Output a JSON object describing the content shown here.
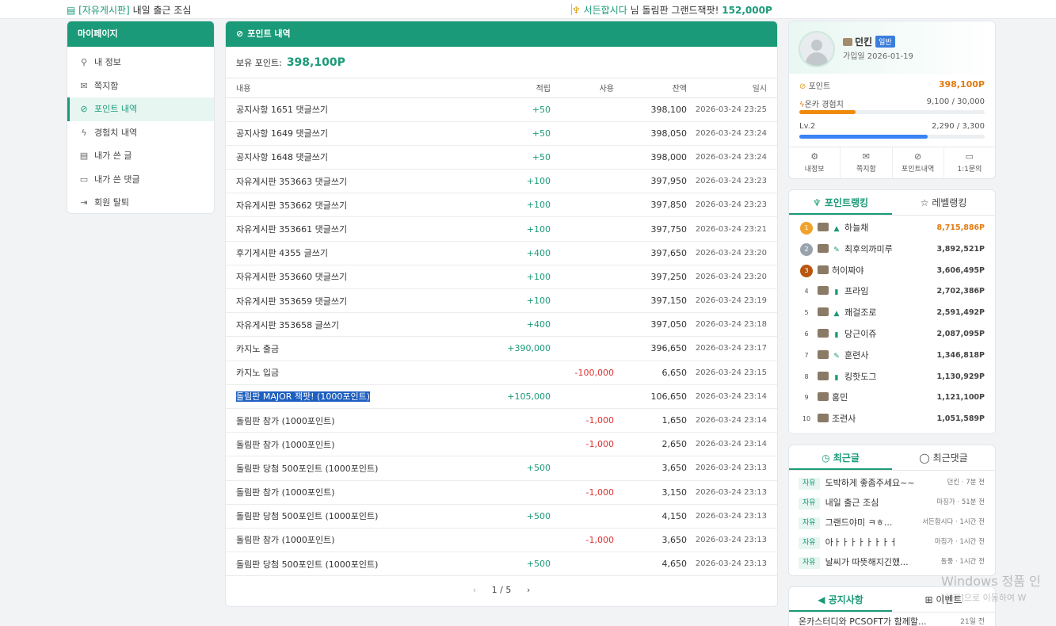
{
  "ticker": {
    "left_category": "[자유게시판]",
    "left_title": "내일 출근 조심",
    "right_nick": "서든합시다",
    "right_suffix": "님",
    "right_text": "돌림판 그랜드잭팟!",
    "right_amount": "152,000P"
  },
  "mypage": {
    "title": "마이페이지",
    "items": [
      {
        "label": "내 정보",
        "icon": "user-icon"
      },
      {
        "label": "쪽지함",
        "icon": "mail-icon"
      },
      {
        "label": "포인트 내역",
        "icon": "link-icon"
      },
      {
        "label": "경험치 내역",
        "icon": "bolt-icon"
      },
      {
        "label": "내가 쓴 글",
        "icon": "document-icon"
      },
      {
        "label": "내가 쓴 댓글",
        "icon": "comment-icon"
      },
      {
        "label": "회원 탈퇴",
        "icon": "logout-icon"
      }
    ]
  },
  "points": {
    "title": "포인트 내역",
    "balance_label": "보유 포인트:",
    "balance_value": "398,100P",
    "columns": [
      "내용",
      "적립",
      "사용",
      "잔액",
      "일시"
    ],
    "rows": [
      {
        "desc": "공지사항 1651 댓글쓰기",
        "earn": "+50",
        "use": "",
        "bal": "398,100",
        "date": "2026-03-24 23:25"
      },
      {
        "desc": "공지사항 1649 댓글쓰기",
        "earn": "+50",
        "use": "",
        "bal": "398,050",
        "date": "2026-03-24 23:24"
      },
      {
        "desc": "공지사항 1648 댓글쓰기",
        "earn": "+50",
        "use": "",
        "bal": "398,000",
        "date": "2026-03-24 23:24"
      },
      {
        "desc": "자유게시판 353663 댓글쓰기",
        "earn": "+100",
        "use": "",
        "bal": "397,950",
        "date": "2026-03-24 23:23"
      },
      {
        "desc": "자유게시판 353662 댓글쓰기",
        "earn": "+100",
        "use": "",
        "bal": "397,850",
        "date": "2026-03-24 23:23"
      },
      {
        "desc": "자유게시판 353661 댓글쓰기",
        "earn": "+100",
        "use": "",
        "bal": "397,750",
        "date": "2026-03-24 23:21"
      },
      {
        "desc": "후기게시판 4355 글쓰기",
        "earn": "+400",
        "use": "",
        "bal": "397,650",
        "date": "2026-03-24 23:20"
      },
      {
        "desc": "자유게시판 353660 댓글쓰기",
        "earn": "+100",
        "use": "",
        "bal": "397,250",
        "date": "2026-03-24 23:20"
      },
      {
        "desc": "자유게시판 353659 댓글쓰기",
        "earn": "+100",
        "use": "",
        "bal": "397,150",
        "date": "2026-03-24 23:19"
      },
      {
        "desc": "자유게시판 353658 글쓰기",
        "earn": "+400",
        "use": "",
        "bal": "397,050",
        "date": "2026-03-24 23:18"
      },
      {
        "desc": "카지노 출금",
        "earn": "+390,000",
        "use": "",
        "bal": "396,650",
        "date": "2026-03-24 23:17"
      },
      {
        "desc": "카지노 입금",
        "earn": "",
        "use": "-100,000",
        "bal": "6,650",
        "date": "2026-03-24 23:15"
      },
      {
        "desc": "돌림판 MAJOR 잭팟! (1000포인트)",
        "earn": "+105,000",
        "use": "",
        "bal": "106,650",
        "date": "2026-03-24 23:14",
        "selected": true
      },
      {
        "desc": "돌림판 참가 (1000포인트)",
        "earn": "",
        "use": "-1,000",
        "bal": "1,650",
        "date": "2026-03-24 23:14"
      },
      {
        "desc": "돌림판 참가 (1000포인트)",
        "earn": "",
        "use": "-1,000",
        "bal": "2,650",
        "date": "2026-03-24 23:14"
      },
      {
        "desc": "돌림판 당첨 500포인트 (1000포인트)",
        "earn": "+500",
        "use": "",
        "bal": "3,650",
        "date": "2026-03-24 23:13"
      },
      {
        "desc": "돌림판 참가 (1000포인트)",
        "earn": "",
        "use": "-1,000",
        "bal": "3,150",
        "date": "2026-03-24 23:13"
      },
      {
        "desc": "돌림판 당첨 500포인트 (1000포인트)",
        "earn": "+500",
        "use": "",
        "bal": "4,150",
        "date": "2026-03-24 23:13"
      },
      {
        "desc": "돌림판 참가 (1000포인트)",
        "earn": "",
        "use": "-1,000",
        "bal": "3,650",
        "date": "2026-03-24 23:13"
      },
      {
        "desc": "돌림판 당첨 500포인트 (1000포인트)",
        "earn": "+500",
        "use": "",
        "bal": "4,650",
        "date": "2026-03-24 23:13"
      }
    ],
    "pager": {
      "prev": "‹",
      "current": "1 / 5",
      "next": "›"
    }
  },
  "profile": {
    "name": "던킨",
    "badge": "일반",
    "joined": "가입일 2026-01-19",
    "points_label": "포인트",
    "points_value": "398,100P",
    "exp_label": "온카 경험치",
    "exp_value": "9,100 / 30,000",
    "exp_fraction": 0.303,
    "level_label": "Lv.2",
    "level_value": "2,290 / 3,300",
    "level_fraction": 0.694,
    "quick": [
      {
        "label": "내정보",
        "icon": "gear-icon"
      },
      {
        "label": "쪽지함",
        "icon": "mail-icon"
      },
      {
        "label": "포인트내역",
        "icon": "link-icon"
      },
      {
        "label": "1:1문의",
        "icon": "chat-icon"
      }
    ]
  },
  "ranking": {
    "tab_points": "포인트랭킹",
    "tab_level": "레벨랭킹",
    "items": [
      {
        "rank": "1",
        "name": "하늘채",
        "pts": "8,715,886P",
        "icon": "cap-icon"
      },
      {
        "rank": "2",
        "name": "최후의까미루",
        "pts": "3,892,521P",
        "icon": "pencil-icon"
      },
      {
        "rank": "3",
        "name": "허이짜야",
        "pts": "3,606,495P",
        "icon": ""
      },
      {
        "rank": "4",
        "name": "프라임",
        "pts": "2,702,386P",
        "icon": "book-icon"
      },
      {
        "rank": "5",
        "name": "쾌걸조로",
        "pts": "2,591,492P",
        "icon": "cap-icon"
      },
      {
        "rank": "6",
        "name": "당근이쥬",
        "pts": "2,087,095P",
        "icon": "book-icon"
      },
      {
        "rank": "7",
        "name": "훈련사",
        "pts": "1,346,818P",
        "icon": "pencil-icon"
      },
      {
        "rank": "8",
        "name": "킹핫도그",
        "pts": "1,130,929P",
        "icon": "book-icon"
      },
      {
        "rank": "9",
        "name": "홍민",
        "pts": "1,121,100P",
        "icon": ""
      },
      {
        "rank": "10",
        "name": "조련사",
        "pts": "1,051,589P",
        "icon": ""
      }
    ]
  },
  "recent": {
    "tab_posts": "최근글",
    "tab_comments": "최근댓글",
    "items": [
      {
        "tag": "자유",
        "title": "도박하게 좋좀주세요~~",
        "meta": "던킨 · 7분 전"
      },
      {
        "tag": "자유",
        "title": "내일 출근 조심",
        "meta": "마징가 · 51분 전"
      },
      {
        "tag": "자유",
        "title": "그랜드야미 ㅋㅎ...",
        "meta": "서든합시다 · 1시간 전"
      },
      {
        "tag": "자유",
        "title": "아ㅏㅏㅏㅏㅏㅏㅏㅓ",
        "meta": "마징가 · 1시간 전"
      },
      {
        "tag": "자유",
        "title": "날씨가 따뜻해지긴했...",
        "meta": "돌풍 · 1시간 전"
      }
    ]
  },
  "notice": {
    "tab_notice": "공지사항",
    "tab_event": "이벤트",
    "first_title": "온카스터디와 PCSOFT가 함께할...",
    "first_meta": "21일 전"
  },
  "watermark": {
    "line1": "Windows 정품 인",
    "line2": "[설정]으로 이동하여 W"
  }
}
